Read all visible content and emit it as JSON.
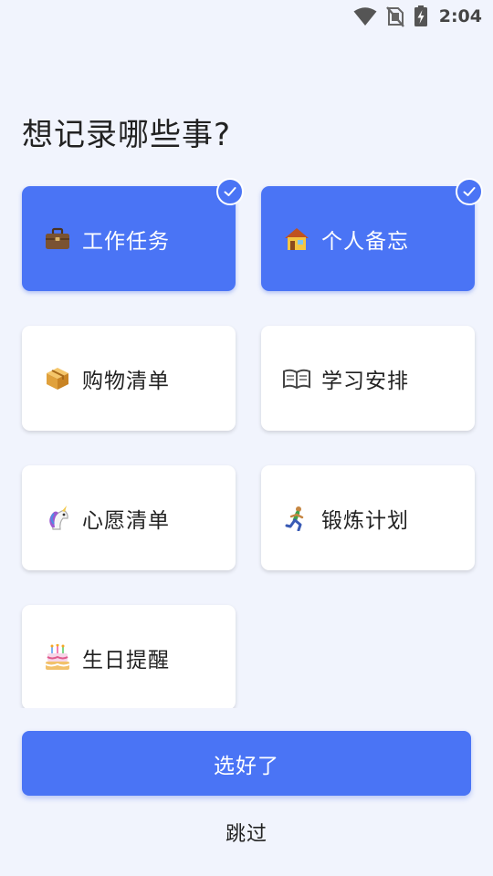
{
  "status_bar": {
    "time": "2:04",
    "icons": [
      "wifi-icon",
      "no-sim-icon",
      "battery-charging-icon"
    ]
  },
  "title": "想记录哪些事?",
  "categories": [
    {
      "label": "工作任务",
      "icon": "briefcase-icon",
      "selected": true
    },
    {
      "label": "个人备忘",
      "icon": "house-icon",
      "selected": true
    },
    {
      "label": "购物清单",
      "icon": "package-icon",
      "selected": false
    },
    {
      "label": "学习安排",
      "icon": "open-book-icon",
      "selected": false
    },
    {
      "label": "心愿清单",
      "icon": "unicorn-icon",
      "selected": false
    },
    {
      "label": "锻炼计划",
      "icon": "runner-icon",
      "selected": false
    },
    {
      "label": "生日提醒",
      "icon": "birthday-cake-icon",
      "selected": false
    }
  ],
  "colors": {
    "accent": "#4a74f5",
    "background": "#f1f4fd",
    "card": "#ffffff"
  },
  "actions": {
    "done_label": "选好了",
    "skip_label": "跳过"
  }
}
